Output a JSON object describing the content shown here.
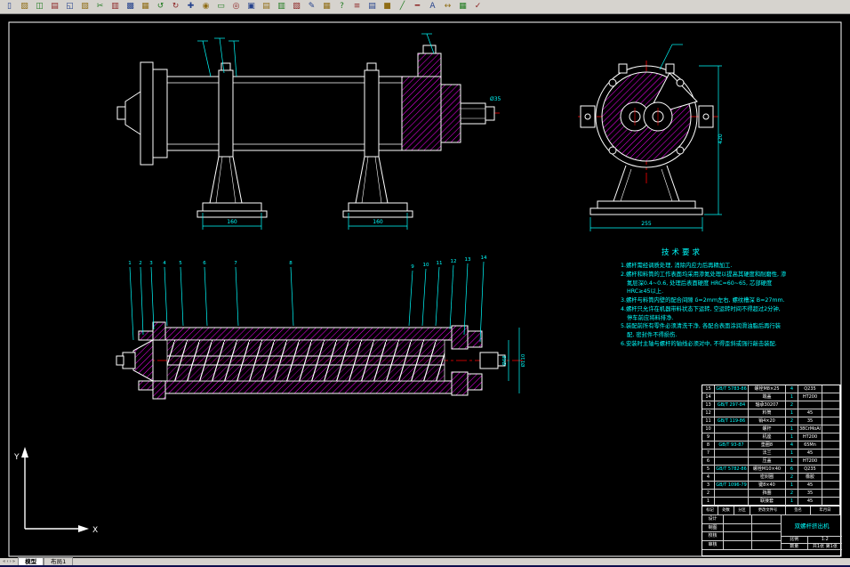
{
  "toolbar": {
    "items": [
      {
        "name": "new",
        "glyph": "▯"
      },
      {
        "name": "open",
        "glyph": "▨"
      },
      {
        "name": "save",
        "glyph": "◫"
      },
      {
        "name": "plot",
        "glyph": "▤"
      },
      {
        "name": "plot-preview",
        "glyph": "◱"
      },
      {
        "name": "publish",
        "glyph": "▧"
      },
      {
        "name": "cut",
        "glyph": "✂"
      },
      {
        "name": "copy",
        "glyph": "▥"
      },
      {
        "name": "paste",
        "glyph": "▩"
      },
      {
        "name": "match-properties",
        "glyph": "▦"
      },
      {
        "name": "undo",
        "glyph": "↺"
      },
      {
        "name": "redo",
        "glyph": "↻"
      },
      {
        "name": "pan",
        "glyph": "✚"
      },
      {
        "name": "zoom-realtime",
        "glyph": "◉"
      },
      {
        "name": "zoom-window",
        "glyph": "▭"
      },
      {
        "name": "zoom-previous",
        "glyph": "◎"
      },
      {
        "name": "properties",
        "glyph": "▣"
      },
      {
        "name": "designcenter",
        "glyph": "▤"
      },
      {
        "name": "tool-palettes",
        "glyph": "▥"
      },
      {
        "name": "sheet-set-manager",
        "glyph": "▧"
      },
      {
        "name": "markup-set-manager",
        "glyph": "✎"
      },
      {
        "name": "quickcalc",
        "glyph": "▦"
      },
      {
        "name": "help",
        "glyph": "?"
      },
      {
        "name": "layers",
        "glyph": "≡"
      },
      {
        "name": "layer-properties",
        "glyph": "▤"
      },
      {
        "name": "color-control",
        "glyph": "■"
      },
      {
        "name": "linetype-control",
        "glyph": "╱"
      },
      {
        "name": "lineweight-control",
        "glyph": "━"
      },
      {
        "name": "text-style",
        "glyph": "A"
      },
      {
        "name": "dim-style",
        "glyph": "↔"
      },
      {
        "name": "table-style",
        "glyph": "▦"
      },
      {
        "name": "standards",
        "glyph": "✓"
      }
    ]
  },
  "tabs": {
    "nav": [
      "«",
      "‹",
      "›",
      "»"
    ],
    "model": "模型",
    "layout1": "布局1"
  },
  "tech_requirements": {
    "title": "技术要求",
    "items": [
      "1.螺杆需经调质处理, 消除内应力后再精加工.",
      "2.螺杆和料筒的工作表面均采用渗氮处理以提高其硬度和耐磨性, 渗氮层深0.4~0.6, 处理后表面硬度 HRC=60~65, 芯部硬度 HRC≥45以上.",
      "3.螺杆与料筒内壁的配合间隙 δ=2mm左右, 螺纹槽深 B=27mm.",
      "4.螺杆只允许在机器带料状态下运转, 空运转时间不得超过2分钟, 停车前应将料排净.",
      "5.装配前所有零件必须清洗干净, 各配合表面涂润滑油脂后再行装配, 密封件不得损伤.",
      "6.安装时主轴与螺杆的轴线必须对中, 不得歪斜或强行敲击装配."
    ]
  },
  "bom": {
    "headers": [
      "序号",
      "代号",
      "名称",
      "数量",
      "材料",
      "备注"
    ],
    "rows": [
      [
        "15",
        "GB/T 5783-86",
        "螺栓M8×25",
        "4",
        "Q235",
        ""
      ],
      [
        "14",
        "",
        "端盖",
        "1",
        "HT200",
        ""
      ],
      [
        "13",
        "GB/T 297-84",
        "轴承30207",
        "2",
        "",
        ""
      ],
      [
        "12",
        "",
        "料筒",
        "1",
        "45",
        ""
      ],
      [
        "11",
        "GB/T 119-86",
        "销4×20",
        "2",
        "35",
        ""
      ],
      [
        "10",
        "",
        "螺杆",
        "1",
        "38CrMoAl",
        ""
      ],
      [
        "9",
        "",
        "机座",
        "1",
        "HT200",
        ""
      ],
      [
        "8",
        "GB/T 93-87",
        "垫圈8",
        "4",
        "65Mn",
        ""
      ],
      [
        "7",
        "",
        "法兰",
        "1",
        "45",
        ""
      ],
      [
        "6",
        "",
        "压盖",
        "1",
        "HT200",
        ""
      ],
      [
        "5",
        "GB/T 5782-86",
        "螺栓M10×40",
        "6",
        "Q235",
        ""
      ],
      [
        "4",
        "",
        "密封圈",
        "2",
        "橡胶",
        ""
      ],
      [
        "3",
        "GB/T 1096-79",
        "键8×40",
        "1",
        "45",
        ""
      ],
      [
        "2",
        "",
        "挡圈",
        "2",
        "35",
        ""
      ],
      [
        "1",
        "",
        "联接套",
        "1",
        "45",
        ""
      ]
    ]
  },
  "title_block": {
    "top_cells": [
      "标记",
      "处数",
      "分区",
      "更改文件号",
      "签名",
      "年月日"
    ],
    "fields": [
      [
        "设计",
        "",
        ""
      ],
      [
        "制图",
        "",
        ""
      ],
      [
        "校核",
        "",
        ""
      ],
      [
        "审核",
        "",
        ""
      ]
    ],
    "name": "双螺杆挤出机",
    "scale_label": "比例",
    "scale": "1:2",
    "qty_label": "数量",
    "sheet": "共1张 第1张"
  },
  "balloons": {
    "left": [
      "1",
      "2",
      "3",
      "4",
      "5",
      "6",
      "7",
      "8"
    ],
    "right": [
      "9",
      "10",
      "11",
      "12",
      "13",
      "14"
    ]
  },
  "dims": {
    "ped1": "160",
    "ped2": "160",
    "base": "255",
    "height": "420",
    "shaft": "Ø35",
    "bore": "Ø48",
    "barrel": "Ø110"
  },
  "ucs": {
    "x_label": "X",
    "y_label": "Y"
  }
}
